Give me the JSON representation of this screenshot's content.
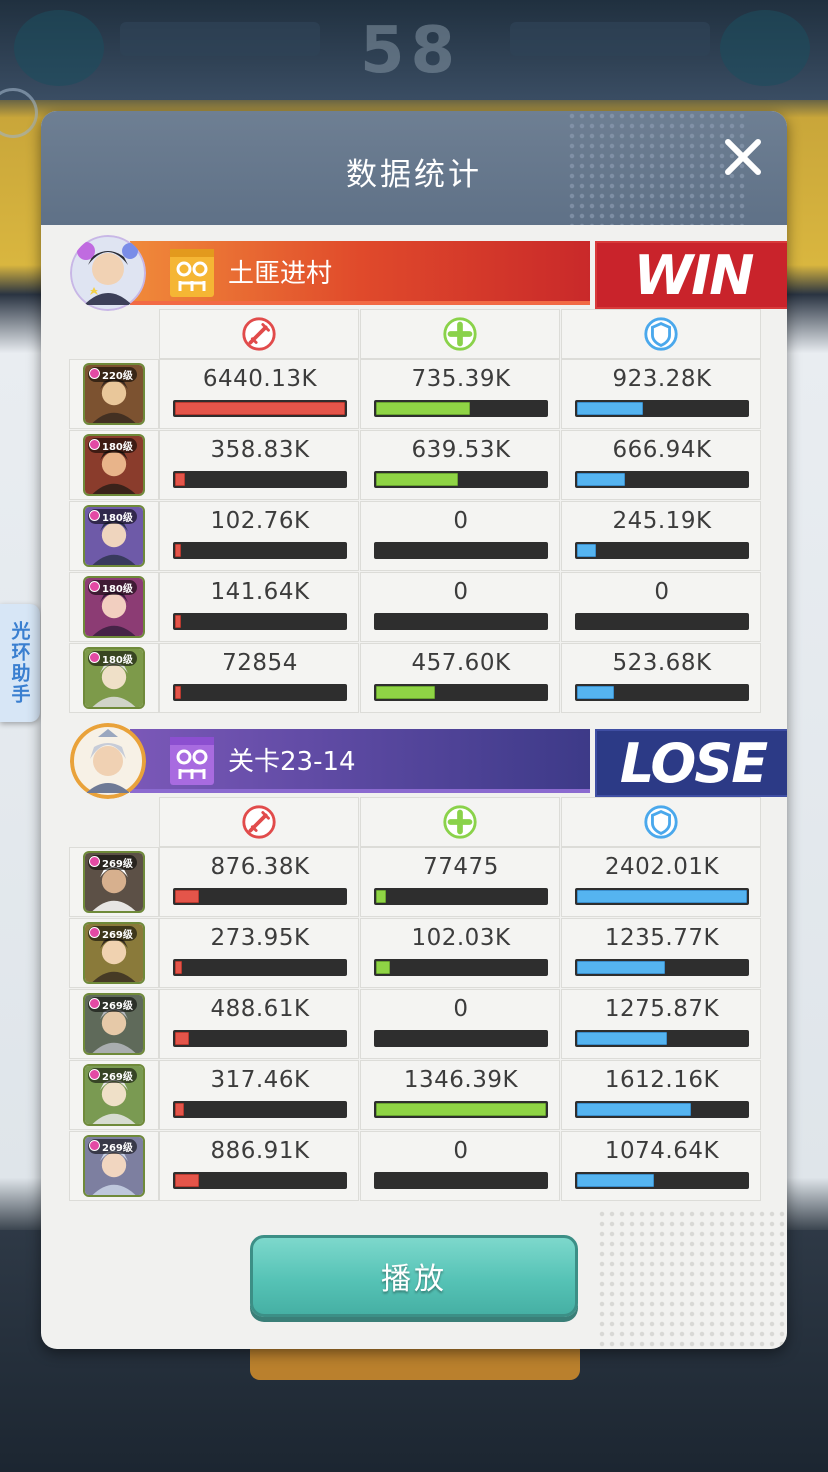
{
  "modal": {
    "title": "数据统计",
    "play_label": "播放"
  },
  "side_tab": {
    "label": "光环助手"
  },
  "colors": {
    "damage": "#e4554a",
    "heal": "#8fd445",
    "tank": "#55b4f0",
    "win_bg": "#c9232b",
    "lose_bg": "#2c3a86"
  },
  "stat_icons": [
    "damage-icon",
    "heal-icon",
    "shield-icon"
  ],
  "team1": {
    "name": "土匪进村",
    "result": "WIN",
    "heroes": [
      {
        "level": "220级",
        "damage": "6440.13K",
        "heal": "735.39K",
        "tank": "923.28K",
        "damage_frac": 1.0,
        "heal_frac": 0.55,
        "tank_frac": 0.39
      },
      {
        "level": "180级",
        "damage": "358.83K",
        "heal": "639.53K",
        "tank": "666.94K",
        "damage_frac": 0.06,
        "heal_frac": 0.48,
        "tank_frac": 0.28
      },
      {
        "level": "180级",
        "damage": "102.76K",
        "heal": "0",
        "tank": "245.19K",
        "damage_frac": 0.02,
        "heal_frac": 0.0,
        "tank_frac": 0.11
      },
      {
        "level": "180级",
        "damage": "141.64K",
        "heal": "0",
        "tank": "0",
        "damage_frac": 0.02,
        "heal_frac": 0.0,
        "tank_frac": 0.0
      },
      {
        "level": "180级",
        "damage": "72854",
        "heal": "457.60K",
        "tank": "523.68K",
        "damage_frac": 0.01,
        "heal_frac": 0.35,
        "tank_frac": 0.22
      }
    ]
  },
  "team2": {
    "name": "关卡23-14",
    "result": "LOSE",
    "heroes": [
      {
        "level": "269级",
        "damage": "876.38K",
        "heal": "77475",
        "tank": "2402.01K",
        "damage_frac": 0.14,
        "heal_frac": 0.06,
        "tank_frac": 1.0
      },
      {
        "level": "269级",
        "damage": "273.95K",
        "heal": "102.03K",
        "tank": "1235.77K",
        "damage_frac": 0.04,
        "heal_frac": 0.08,
        "tank_frac": 0.52
      },
      {
        "level": "269级",
        "damage": "488.61K",
        "heal": "0",
        "tank": "1275.87K",
        "damage_frac": 0.08,
        "heal_frac": 0.0,
        "tank_frac": 0.53
      },
      {
        "level": "269级",
        "damage": "317.46K",
        "heal": "1346.39K",
        "tank": "1612.16K",
        "damage_frac": 0.05,
        "heal_frac": 1.0,
        "tank_frac": 0.67
      },
      {
        "level": "269级",
        "damage": "886.91K",
        "heal": "0",
        "tank": "1074.64K",
        "damage_frac": 0.14,
        "heal_frac": 0.0,
        "tank_frac": 0.45
      }
    ]
  },
  "background": {
    "score_text": "58"
  }
}
